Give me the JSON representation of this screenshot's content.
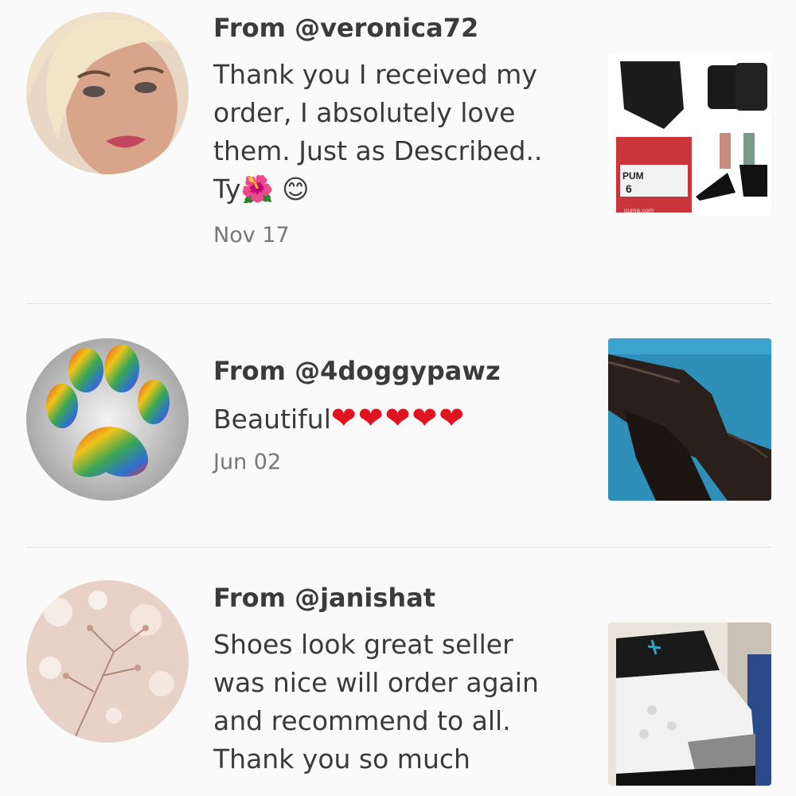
{
  "reviews": [
    {
      "from": "From @veronica72",
      "comment": "Thank you I received my order, I absolutely love them. Just as Described.. Ty🌺 😊",
      "date": "Nov 17",
      "avatar_icon": "woman-portrait-avatar",
      "thumb_icon": "black-puma-sneakers-photo"
    },
    {
      "from": "From @4doggypawz",
      "comment": "Beautiful",
      "comment_hearts": "❤❤❤❤❤",
      "date": "Jun 02",
      "avatar_icon": "paw-print-avatar",
      "thumb_icon": "brown-leather-boots-photo"
    },
    {
      "from": "From @janishat",
      "comment": "Shoes look great seller was nice will order again and recommend to all. Thank you so much",
      "avatar_icon": "floral-bokeh-avatar",
      "thumb_icon": "jordan-sneakers-photo"
    }
  ],
  "thumb_labels": {
    "box_brand": "PUM",
    "box_size": "6",
    "box_site": "puma.com"
  },
  "colors": {
    "background": "#fafafa",
    "divider": "#dedede",
    "heart": "#e0141e"
  }
}
